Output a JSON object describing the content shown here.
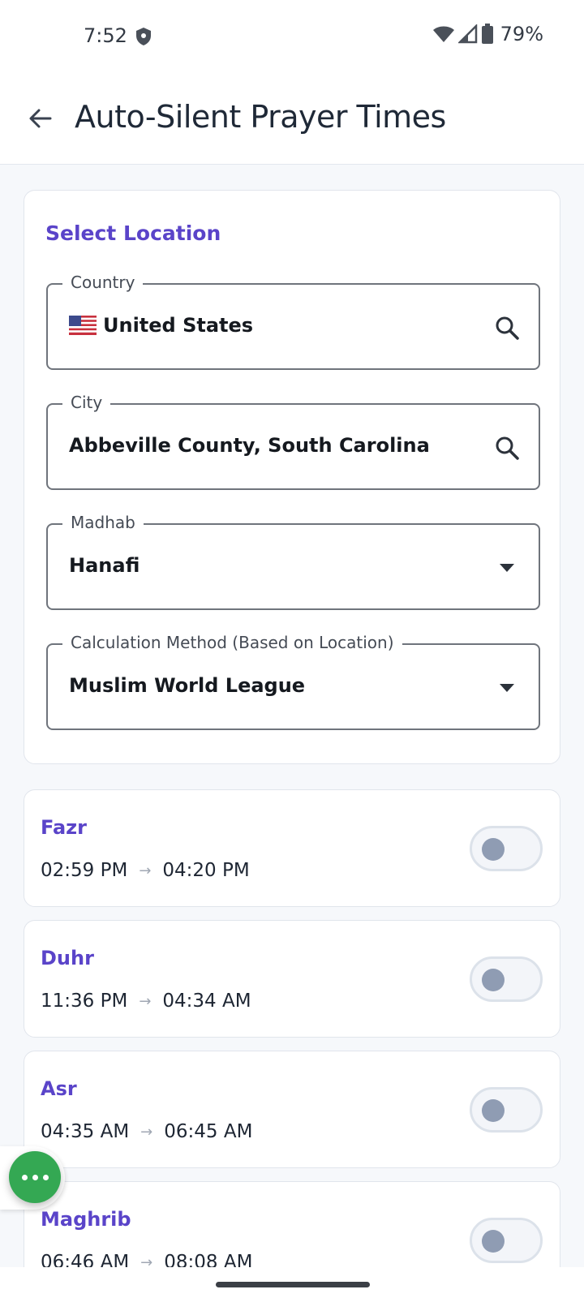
{
  "status_bar": {
    "time": "7:52",
    "battery_percent": "79%"
  },
  "app_bar": {
    "title": "Auto-Silent Prayer Times"
  },
  "location": {
    "section_title": "Select Location",
    "country": {
      "label": "Country",
      "value": "United States"
    },
    "city": {
      "label": "City",
      "value": "Abbeville County, South Carolina"
    },
    "madhab": {
      "label": "Madhab",
      "value": "Hanafi"
    },
    "method": {
      "label": "Calculation Method (Based on Location)",
      "value": "Muslim World League"
    }
  },
  "prayers": [
    {
      "name": "Fazr",
      "start": "02:59 PM",
      "end": "04:20 PM",
      "enabled": false
    },
    {
      "name": "Duhr",
      "start": "11:36 PM",
      "end": "04:34 AM",
      "enabled": false
    },
    {
      "name": "Asr",
      "start": "04:35 AM",
      "end": "06:45 AM",
      "enabled": false
    },
    {
      "name": "Maghrib",
      "start": "06:46 AM",
      "end": "08:08 AM",
      "enabled": false
    }
  ],
  "arrow_glyph": "→",
  "colors": {
    "accent": "#5a44c9",
    "fab": "#34a853",
    "toggle_off_knob": "#8f9cb3"
  }
}
